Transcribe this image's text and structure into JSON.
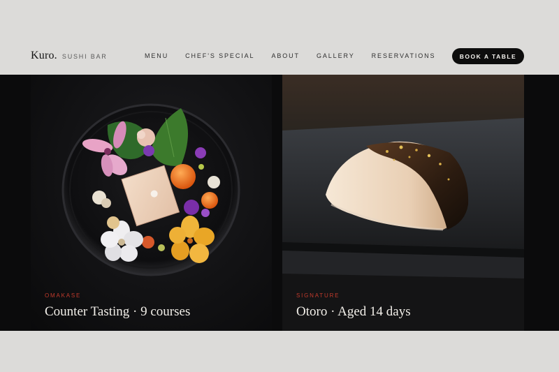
{
  "brand": {
    "logo": "Kuro.",
    "subtitle": "SUSHI BAR"
  },
  "nav": {
    "items": [
      {
        "label": "MENU"
      },
      {
        "label": "CHEF'S SPECIAL"
      },
      {
        "label": "ABOUT"
      },
      {
        "label": "GALLERY"
      },
      {
        "label": "RESERVATIONS"
      }
    ]
  },
  "cta": {
    "label": "BOOK A TABLE"
  },
  "cards": [
    {
      "eyebrow": "OMAKASE",
      "title": "Counter Tasting · 9 courses"
    },
    {
      "eyebrow": "SIGNATURE",
      "title": "Otoro · Aged 14 days"
    }
  ],
  "colors": {
    "background": "#dcdbd9",
    "accent": "#c23a2c",
    "button": "#0d0d0d"
  }
}
